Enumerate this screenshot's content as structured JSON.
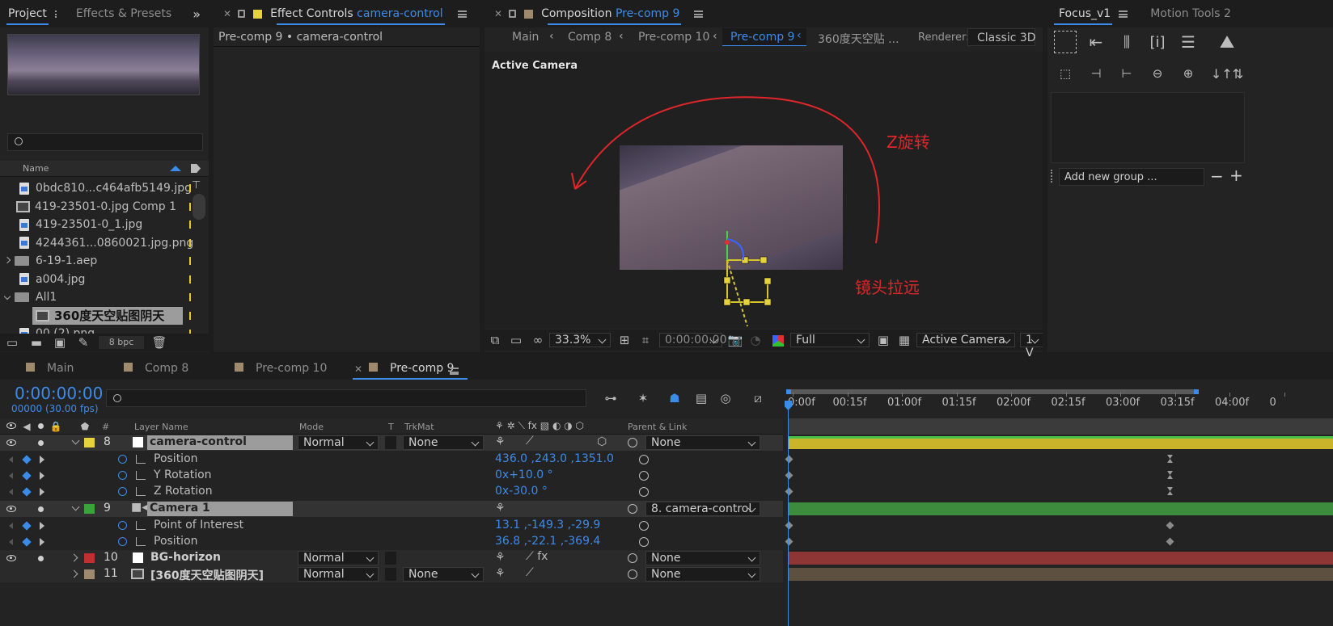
{
  "project_panel": {
    "tabs": [
      "Project",
      "Effects & Presets"
    ],
    "more": "»",
    "search_placeholder": "",
    "col_name": "Name",
    "items": [
      {
        "name": "0bdc810...c464afb5149.jpg",
        "type": "file"
      },
      {
        "name": "419-23501-0.jpg Comp 1",
        "type": "comp"
      },
      {
        "name": "419-23501-0_1.jpg",
        "type": "file"
      },
      {
        "name": "4244361...0860021.jpg.png",
        "type": "file"
      },
      {
        "name": "6-19-1.aep",
        "type": "folder"
      },
      {
        "name": "a004.jpg",
        "type": "file"
      },
      {
        "name": "All1",
        "type": "folder"
      },
      {
        "name": "360度天空贴图阴天",
        "type": "comp"
      },
      {
        "name": "00 (2).png",
        "type": "file"
      }
    ],
    "bpc": "8 bpc"
  },
  "effect_controls": {
    "tab_prefix": "Effect Controls",
    "tab_layer": "camera-control",
    "subtitle": "Pre-comp 9 • camera-control",
    "color": "#e6d23c"
  },
  "composition": {
    "tab_prefix": "Composition",
    "tab_comp": "Pre-comp 9",
    "breadcrumbs": [
      "Main",
      "Comp 8",
      "Pre-comp 10",
      "Pre-comp 9",
      "360度天空贴 ..."
    ],
    "renderer_label": "Renderer:",
    "renderer_value": "Classic 3D",
    "active_camera_label": "Active Camera",
    "annotation_z": "Z旋转",
    "annotation_pull": "镜头拉远",
    "annotation_color": "#e0262a",
    "footer": {
      "zoom": "33.3%",
      "timecode": "0:00:00:00",
      "resolution": "Full",
      "view": "Active Camera",
      "views": "1 V"
    }
  },
  "focus_panel": {
    "tabs": [
      "Focus_v1",
      "Motion Tools 2"
    ],
    "add_group_placeholder": "Add new group ...",
    "minus": "−",
    "plus": "+"
  },
  "timeline": {
    "tabs": [
      "Main",
      "Comp 8",
      "Pre-comp 10",
      "Pre-comp 9"
    ],
    "tab_colors": [
      "#a08a6e",
      "#a08a6e",
      "#a08a6e",
      "#a08a6e"
    ],
    "timecode": "0:00:00:00",
    "frames": "00000 (30.00 fps)",
    "columns": {
      "hash": "#",
      "layer_name": "Layer Name",
      "mode": "Mode",
      "t": "T",
      "trkmat": "TrkMat",
      "parent": "Parent & Link"
    },
    "ruler": [
      "0:00f",
      "00:15f",
      "01:00f",
      "01:15f",
      "02:00f",
      "02:15f",
      "03:00f",
      "03:15f",
      "04:00f",
      "0"
    ],
    "layers": [
      {
        "num": "8",
        "name": "camera-control",
        "color": "#e6d23c",
        "mode": "Normal",
        "trkmat": "None",
        "parent": "None",
        "bar_color": "#c9b42a"
      },
      {
        "num": "9",
        "name": "Camera 1",
        "color": "#3aa33a",
        "parent": "8. camera-control",
        "bar_color": "#3d8c3d"
      },
      {
        "num": "10",
        "name": "BG-horizon",
        "color": "#c03030",
        "mode": "Normal",
        "parent": "None",
        "bar_color": "#8e3535"
      },
      {
        "num": "11",
        "name": "[360度天空贴图阴天]",
        "color": "#a08a6e",
        "mode": "Normal",
        "trkmat": "None",
        "parent": "None",
        "bar_color": "#5d5040"
      }
    ],
    "props": {
      "cc_position": {
        "name": "Position",
        "value": "436.0 ,243.0 ,1351.0"
      },
      "cc_yrot": {
        "name": "Y Rotation",
        "value": "0x+10.0 °"
      },
      "cc_zrot": {
        "name": "Z Rotation",
        "value": "0x-30.0 °"
      },
      "cam_poi": {
        "name": "Point of Interest",
        "value": "13.1 ,-149.3 ,-29.9"
      },
      "cam_pos": {
        "name": "Position",
        "value": "36.8 ,-22.1 ,-369.4"
      }
    }
  }
}
